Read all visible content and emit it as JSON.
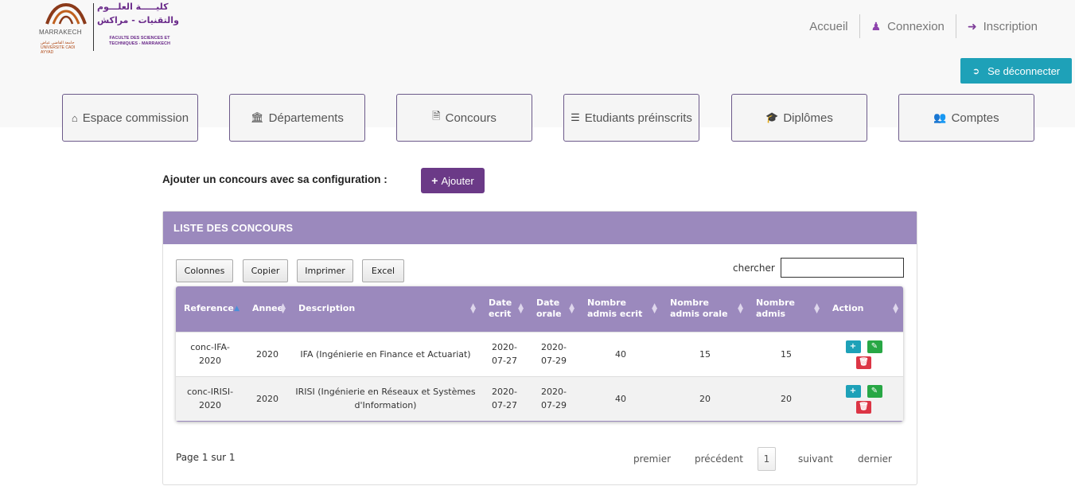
{
  "logo": {
    "arabic_line1": "كليـــــة العلـــوم",
    "arabic_line2": "والتقنيات - مراكش",
    "french": "FACULTE DES SCIENCES ET TECHNIQUES - MARRAKECH",
    "marrakech": "MARRAKECH",
    "university": "جامعة القاضي عياض UNIVERSITE CADI AYYAD"
  },
  "topnav": {
    "home": "Accueil",
    "login": "Connexion",
    "register": "Inscription"
  },
  "logout": "Se déconnecter",
  "menu": [
    {
      "label": "Espace commission",
      "icon": "home-icon"
    },
    {
      "label": "Départements",
      "icon": "institution-icon"
    },
    {
      "label": "Concours",
      "icon": "file-text-icon"
    },
    {
      "label": "Etudiants préinscrits",
      "icon": "list-icon"
    },
    {
      "label": "Diplômes",
      "icon": "graduation-cap-icon"
    },
    {
      "label": "Comptes",
      "icon": "users-icon"
    }
  ],
  "add": {
    "label": "Ajouter un concours avec sa configuration :",
    "button": "Ajouter"
  },
  "panel": {
    "title": "LISTE DES CONCOURS"
  },
  "toolbar": {
    "columns": "Colonnes",
    "copy": "Copier",
    "print": "Imprimer",
    "excel": "Excel",
    "search_label": "chercher",
    "search_value": ""
  },
  "table": {
    "headers": {
      "reference": "Reference",
      "annee": "Annee",
      "description": "Description",
      "date_ecrit_1": "Date",
      "date_ecrit_2": "ecrit",
      "date_orale_1": "Date",
      "date_orale_2": "orale",
      "nae_1": "Nombre",
      "nae_2": "admis ecrit",
      "nao_1": "Nombre",
      "nao_2": "admis orale",
      "na_1": "Nombre",
      "na_2": "admis",
      "action": "Action"
    },
    "rows": [
      {
        "ref_1": "conc-IFA-",
        "ref_2": "2020",
        "annee": "2020",
        "desc_1": "IFA (Ingénierie en Finance et Actuariat)",
        "desc_2": "",
        "de_1": "2020-",
        "de_2": "07-27",
        "do_1": "2020-",
        "do_2": "07-29",
        "nae": "40",
        "nao": "15",
        "na": "15"
      },
      {
        "ref_1": "conc-IRISI-",
        "ref_2": "2020",
        "annee": "2020",
        "desc_1": "IRISI (Ingénierie en Réseaux et Systèmes",
        "desc_2": "d'Information)",
        "de_1": "2020-",
        "de_2": "07-27",
        "do_1": "2020-",
        "do_2": "07-29",
        "nae": "40",
        "nao": "20",
        "na": "20"
      }
    ]
  },
  "pagination": {
    "info": "Page 1 sur 1",
    "first": "premier",
    "prev": "précédent",
    "current": "1",
    "next": "suivant",
    "last": "dernier"
  },
  "colors": {
    "accent": "#9b89bd",
    "brand": "#6b3a87",
    "info": "#1ea1b8",
    "success": "#28a745",
    "danger": "#dc3545"
  }
}
